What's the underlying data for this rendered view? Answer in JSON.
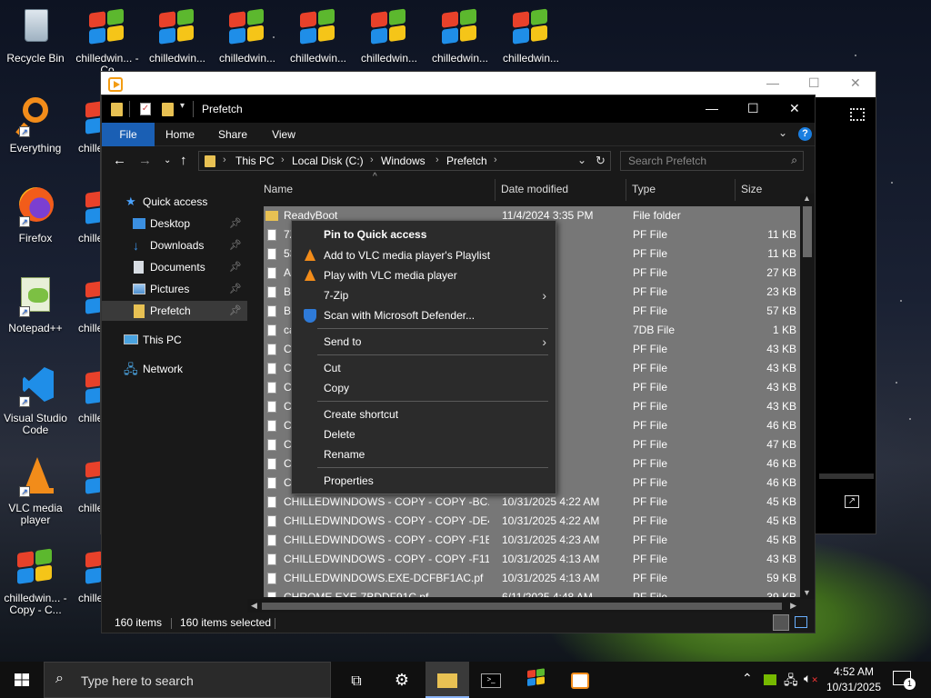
{
  "desktop": {
    "icons": [
      {
        "label": "Recycle Bin",
        "icon": "recycle-bin-icon"
      },
      {
        "label": "Everything",
        "icon": "everything-search-icon"
      },
      {
        "label": "Firefox",
        "icon": "firefox-icon"
      },
      {
        "label": "Notepad++",
        "icon": "notepad-plus-plus-icon"
      },
      {
        "label": "Visual Studio Code",
        "icon": "vscode-icon"
      },
      {
        "label": "VLC media player",
        "icon": "vlc-icon"
      },
      {
        "label": "chilledwin... - Copy - C...",
        "icon": "windows-logo-icon"
      }
    ],
    "top_icons": [
      "chilledwin... - Co",
      "chilledwin...",
      "chilledwin...",
      "chilledwin...",
      "chilledwin...",
      "chilledwin...",
      "chilledwin..."
    ],
    "column2_labels": [
      "chille - Co",
      "chille - Co",
      "chille - Co",
      "chille - Co",
      "chille - Co",
      "chille - Co"
    ]
  },
  "explorer": {
    "title": "Prefetch",
    "ribbon": {
      "file": "File",
      "home": "Home",
      "share": "Share",
      "view": "View"
    },
    "address": {
      "crumbs": [
        "This PC",
        "Local Disk (C:)",
        "Windows",
        "Prefetch"
      ]
    },
    "search": {
      "placeholder": "Search Prefetch"
    },
    "nav": {
      "quick_access": "Quick access",
      "items": [
        {
          "label": "Desktop",
          "pinned": true
        },
        {
          "label": "Downloads",
          "pinned": true
        },
        {
          "label": "Documents",
          "pinned": true
        },
        {
          "label": "Pictures",
          "pinned": true
        },
        {
          "label": "Prefetch",
          "pinned": true
        }
      ],
      "this_pc": "This PC",
      "network": "Network"
    },
    "columns": {
      "name": "Name",
      "date": "Date modified",
      "type": "Type",
      "size": "Size"
    },
    "rows": [
      {
        "name": "ReadyBoot",
        "date": "11/4/2024 3:35 PM",
        "type": "File folder",
        "size": "",
        "folder": true
      },
      {
        "name": "7Z",
        "date": "14 AM",
        "type": "PF File",
        "size": "11 KB"
      },
      {
        "name": "53",
        "date": "11:25 PM",
        "type": "PF File",
        "size": "11 KB"
      },
      {
        "name": "AF",
        "date": ":59 AM",
        "type": "PF File",
        "size": "27 KB"
      },
      {
        "name": "BA",
        "date": ":59 AM",
        "type": "PF File",
        "size": "23 KB"
      },
      {
        "name": "BL",
        "date": ":47 AM",
        "type": "PF File",
        "size": "57 KB"
      },
      {
        "name": "ca",
        "date": ":30 AM",
        "type": "7DB File",
        "size": "1 KB"
      },
      {
        "name": "CH",
        "date": ":13 AM",
        "type": "PF File",
        "size": "43 KB"
      },
      {
        "name": "CH",
        "date": ":13 AM",
        "type": "PF File",
        "size": "43 KB"
      },
      {
        "name": "CH",
        "date": ":23 AM",
        "type": "PF File",
        "size": "43 KB"
      },
      {
        "name": "CH",
        "date": ":51 AM",
        "type": "PF File",
        "size": "43 KB"
      },
      {
        "name": "CH",
        "date": ":13 AM",
        "type": "PF File",
        "size": "46 KB"
      },
      {
        "name": "CH",
        "date": ":23 AM",
        "type": "PF File",
        "size": "47 KB"
      },
      {
        "name": "CH",
        "date": ":23 AM",
        "type": "PF File",
        "size": "46 KB"
      },
      {
        "name": "CH",
        "date": ":23 AM",
        "type": "PF File",
        "size": "46 KB"
      },
      {
        "name": "CHILLEDWINDOWS - COPY - COPY -BC...",
        "date": "10/31/2025 4:22 AM",
        "type": "PF File",
        "size": "45 KB"
      },
      {
        "name": "CHILLEDWINDOWS - COPY - COPY -DE4...",
        "date": "10/31/2025 4:22 AM",
        "type": "PF File",
        "size": "45 KB"
      },
      {
        "name": "CHILLEDWINDOWS - COPY - COPY -F1E...",
        "date": "10/31/2025 4:23 AM",
        "type": "PF File",
        "size": "45 KB"
      },
      {
        "name": "CHILLEDWINDOWS - COPY - COPY -F11...",
        "date": "10/31/2025 4:13 AM",
        "type": "PF File",
        "size": "43 KB"
      },
      {
        "name": "CHILLEDWINDOWS.EXE-DCFBF1AC.pf",
        "date": "10/31/2025 4:13 AM",
        "type": "PF File",
        "size": "59 KB"
      },
      {
        "name": "CHROME.EXE-7BDDF91C.pf",
        "date": "6/11/2025 4:48 AM",
        "type": "PF File",
        "size": "39 KB"
      }
    ],
    "status": {
      "count": "160 items",
      "selected": "160 items selected"
    }
  },
  "context_menu": {
    "items": [
      {
        "label": "Pin to Quick access",
        "bold": true,
        "icon": ""
      },
      {
        "label": "Add to VLC media player's Playlist",
        "icon": "vlc-cone-icon"
      },
      {
        "label": "Play with VLC media player",
        "icon": "vlc-cone-icon"
      },
      {
        "label": "7-Zip",
        "submenu": true
      },
      {
        "label": "Scan with Microsoft Defender...",
        "icon": "defender-shield-icon"
      },
      {
        "label": "Send to",
        "submenu": true
      },
      {
        "label": "Cut"
      },
      {
        "label": "Copy"
      },
      {
        "label": "Create shortcut"
      },
      {
        "label": "Delete"
      },
      {
        "label": "Rename"
      },
      {
        "label": "Properties"
      }
    ]
  },
  "taskbar": {
    "search_placeholder": "Type here to search",
    "time": "4:52 AM",
    "date": "10/31/2025",
    "notification_count": "1"
  },
  "colors": {
    "selection": "#777777",
    "accent": "#1a5fb4",
    "taskbar": "#101010"
  }
}
